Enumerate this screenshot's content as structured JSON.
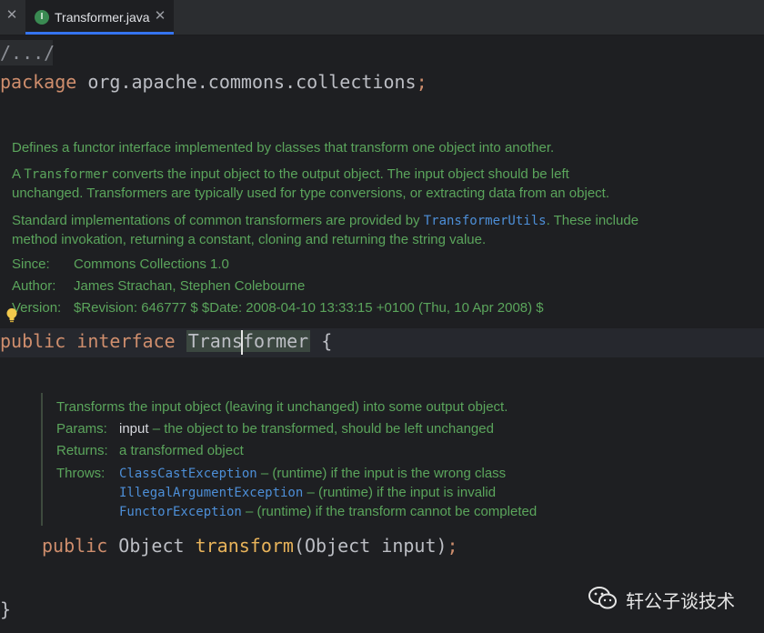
{
  "tabs": [
    {
      "title": "Transformer.java",
      "icon": "java-interface-icon",
      "active": true
    }
  ],
  "editor": {
    "fold_text": "/.../",
    "package_kw": "package",
    "package_name": " org.apache.commons.collections",
    "semicolon": ";",
    "class_doc": {
      "p1": "Defines a functor interface implemented by classes that transform one object into another.",
      "p2_a": "A ",
      "p2_code": "Transformer",
      "p2_b": " converts the input object to the output object. The input object should be left",
      "p2_line2": "unchanged. Transformers are typically used for type conversions, or extracting data from an object.",
      "p3_a": "Standard implementations of common transformers are provided by ",
      "p3_link": "TransformerUtils",
      "p3_b": ". These include",
      "p3_line2": "method invokation, returning a constant, cloning and returning the string value.",
      "since_label": "Since:",
      "since_value": "Commons Collections 1.0",
      "author_label": "Author:",
      "author_value": "James Strachan, Stephen Colebourne",
      "version_label": "Version:",
      "version_value": "$Revision: 646777 $ $Date: 2008-04-10 13:33:15 +0100 (Thu, 10 Apr 2008) $"
    },
    "decl": {
      "kw1": "public",
      "kw2": "interface",
      "name_a": "Trans",
      "name_b": "former",
      "brace": "{"
    },
    "method_doc": {
      "summary": "Transforms the input object (leaving it unchanged) into some output object.",
      "params_label": "Params:",
      "param_name": "input",
      "param_desc": " – the object to be transformed, should be left unchanged",
      "returns_label": "Returns:",
      "returns_value": "a transformed object",
      "throws_label": "Throws:",
      "throws": [
        {
          "ex": "ClassCastException",
          "desc": " – (runtime) if the input is the wrong class"
        },
        {
          "ex": "IllegalArgumentException",
          "desc": " – (runtime) if the input is invalid"
        },
        {
          "ex": "FunctorException",
          "desc": " – (runtime) if the transform cannot be completed"
        }
      ]
    },
    "method": {
      "kw": "public",
      "type": " Object ",
      "name": "transform",
      "params": "(Object input)",
      "semicolon": ";"
    },
    "closing_brace": "}"
  },
  "watermark": {
    "text": "轩公子谈技术",
    "icon": "wechat-icon"
  },
  "colors": {
    "background": "#1e1f22",
    "keyword": "#cf8e6d",
    "doc": "#5ba55c",
    "link": "#4d8fd8",
    "method": "#e8b35a",
    "accent": "#3574f0"
  }
}
